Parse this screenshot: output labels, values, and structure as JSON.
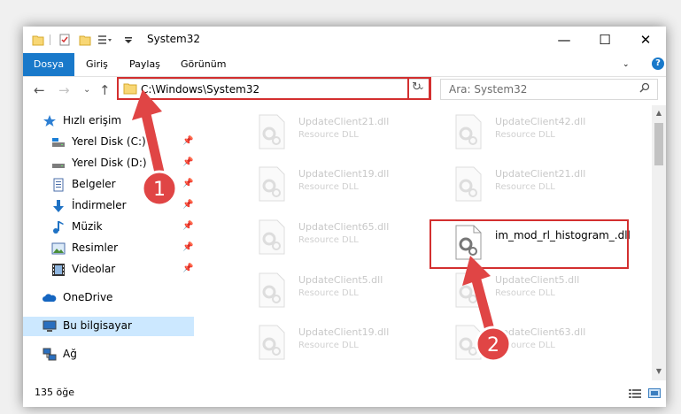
{
  "window": {
    "title": "System32",
    "controls": {
      "minimize": "—",
      "maximize": "☐",
      "close": "✕"
    }
  },
  "ribbon": {
    "file_tab": "Dosya",
    "tabs": [
      "Giriş",
      "Paylaş",
      "Görünüm"
    ],
    "help": "?"
  },
  "navigation": {
    "address": "C:\\Windows\\System32",
    "search_placeholder": "Ara: System32"
  },
  "sidebar": {
    "items": [
      {
        "label": "Hızlı erişim",
        "icon": "star-icon",
        "pinned": false
      },
      {
        "label": "Yerel Disk (C:)",
        "icon": "drive-icon",
        "pinned": true
      },
      {
        "label": "Yerel Disk (D:)",
        "icon": "drive-icon",
        "pinned": true
      },
      {
        "label": "Belgeler",
        "icon": "documents-icon",
        "pinned": true
      },
      {
        "label": "İndirmeler",
        "icon": "download-icon",
        "pinned": true
      },
      {
        "label": "Müzik",
        "icon": "music-icon",
        "pinned": true
      },
      {
        "label": "Resimler",
        "icon": "pictures-icon",
        "pinned": true
      },
      {
        "label": "Videolar",
        "icon": "videos-icon",
        "pinned": true
      },
      {
        "label": "OneDrive",
        "icon": "cloud-icon",
        "pinned": false
      },
      {
        "label": "Bu bilgisayar",
        "icon": "computer-icon",
        "pinned": false,
        "selected": true
      },
      {
        "label": "Ağ",
        "icon": "network-icon",
        "pinned": false
      }
    ]
  },
  "files": {
    "left": [
      {
        "name": "UpdateClient21.dll",
        "desc": "Resource DLL"
      },
      {
        "name": "UpdateClient19.dll",
        "desc": "Resource DLL"
      },
      {
        "name": "UpdateClient65.dll",
        "desc": "Resource DLL"
      },
      {
        "name": "UpdateClient5.dll",
        "desc": "Resource DLL"
      },
      {
        "name": "UpdateClient19.dll",
        "desc": "Resource DLL"
      }
    ],
    "right": [
      {
        "name": "UpdateClient42.dll",
        "desc": "Resource DLL"
      },
      {
        "name": "UpdateClient21.dll",
        "desc": "Resource DLL"
      },
      {
        "name": "im_mod_rl_histogram_.dll",
        "desc": ""
      },
      {
        "name": "UpdateClient5.dll",
        "desc": "Resource DLL"
      },
      {
        "name": "UpdateClient63.dll",
        "desc": "Resource DLL"
      }
    ]
  },
  "status": {
    "item_count": "135 öğe"
  },
  "annotations": {
    "step1": "1",
    "step2": "2"
  },
  "colors": {
    "accent": "#1979ca",
    "highlight": "#d32f2f",
    "badge": "#e04545"
  }
}
